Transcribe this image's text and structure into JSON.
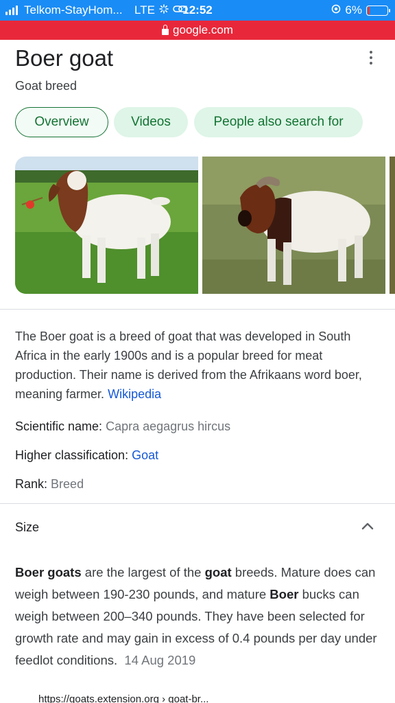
{
  "status_bar": {
    "carrier": "Telkom-StayHom...",
    "network": "LTE",
    "time": "12:52",
    "battery": "6%"
  },
  "url_bar": {
    "domain": "google.com"
  },
  "header": {
    "title": "Boer goat",
    "subtitle": "Goat breed"
  },
  "tabs": [
    {
      "label": "Overview",
      "active": true
    },
    {
      "label": "Videos",
      "active": false
    },
    {
      "label": "People also search for",
      "active": false
    }
  ],
  "description": {
    "text": "The Boer goat is a breed of goat that was developed in South Africa in the early 1900s and is a popular breed for meat production. Their name is derived from the Afrikaans word boer, meaning farmer.",
    "source_link": "Wikipedia"
  },
  "facts": [
    {
      "label": "Scientific name:",
      "value": "Capra aegagrus hircus",
      "is_link": false
    },
    {
      "label": "Higher classification:",
      "value": "Goat",
      "is_link": true
    },
    {
      "label": "Rank:",
      "value": "Breed",
      "is_link": false
    }
  ],
  "size_section": {
    "heading": "Size",
    "expanded": true,
    "snippet": {
      "part1_bold": "Boer goats",
      "part2": " are the largest of the ",
      "part3_bold": "goat",
      "part4": " breeds. Mature does can weigh between 190-230 pounds, and mature ",
      "part5_bold": "Boer",
      "part6": " bucks can weigh between 200–340 pounds. They have been selected for growth rate and may gain in excess of 0.4 pounds per day under feedlot conditions.",
      "date": "14 Aug 2019"
    },
    "source_url": "https://goats.extension.org › goat-br..."
  },
  "colors": {
    "status_bar": "#1a8cf5",
    "url_bar": "#e8283a",
    "chip_text": "#137333",
    "chip_bg": "#def5e7",
    "link": "#1558d6"
  },
  "icons": [
    "signal-icon",
    "activity-icon",
    "link-icon",
    "lock-icon",
    "alarm-icon",
    "battery-icon",
    "more-vert-icon",
    "chevron-up-icon"
  ]
}
